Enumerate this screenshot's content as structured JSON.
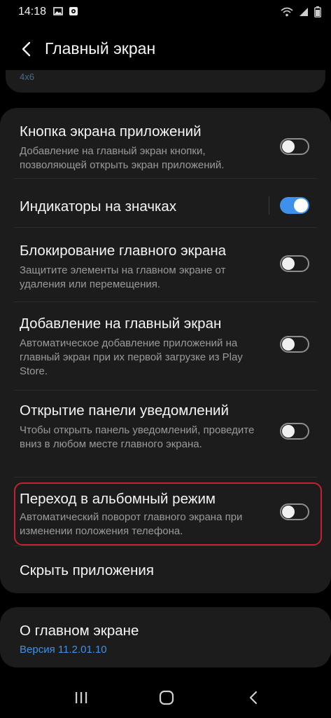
{
  "status_bar": {
    "time": "14:18",
    "left_icons": [
      "image-icon",
      "notification-app-icon"
    ],
    "right_icons": [
      "wifi-icon",
      "signal-icon",
      "battery-icon"
    ]
  },
  "app_bar": {
    "title": "Главный экран"
  },
  "peek_text": "4x6",
  "settings": [
    {
      "title": "Кнопка экрана приложений",
      "description": "Добавление на главный экран кнопки, позволяющей открыть экран приложений.",
      "enabled": false
    },
    {
      "title": "Индикаторы на значках",
      "description": "",
      "enabled": true
    },
    {
      "title": "Блокирование главного экрана",
      "description": "Защитите элементы на главном экране от удаления или перемещения.",
      "enabled": false
    },
    {
      "title": "Добавление на главный экран",
      "description": "Автоматическое добавление приложений на главный экран при их первой загрузке из Play Store.",
      "enabled": false
    },
    {
      "title": "Открытие панели уведомлений",
      "description": "Чтобы открыть панель уведомлений, проведите вниз в любом месте главного экрана.",
      "enabled": false
    },
    {
      "title": "Переход в альбомный режим",
      "description": "Автоматический поворот главного экрана при изменении положения телефона.",
      "enabled": false
    },
    {
      "title": "Скрыть приложения",
      "description": ""
    }
  ],
  "about": {
    "title": "О главном экране",
    "version": "Версия 11.2.01.10"
  },
  "colors": {
    "accent": "#3e91ea",
    "highlight": "#c12332",
    "card": "#1c1c1c",
    "background": "#000000"
  },
  "navbar": {
    "icons": [
      "recents-icon",
      "home-icon",
      "back-icon"
    ]
  }
}
